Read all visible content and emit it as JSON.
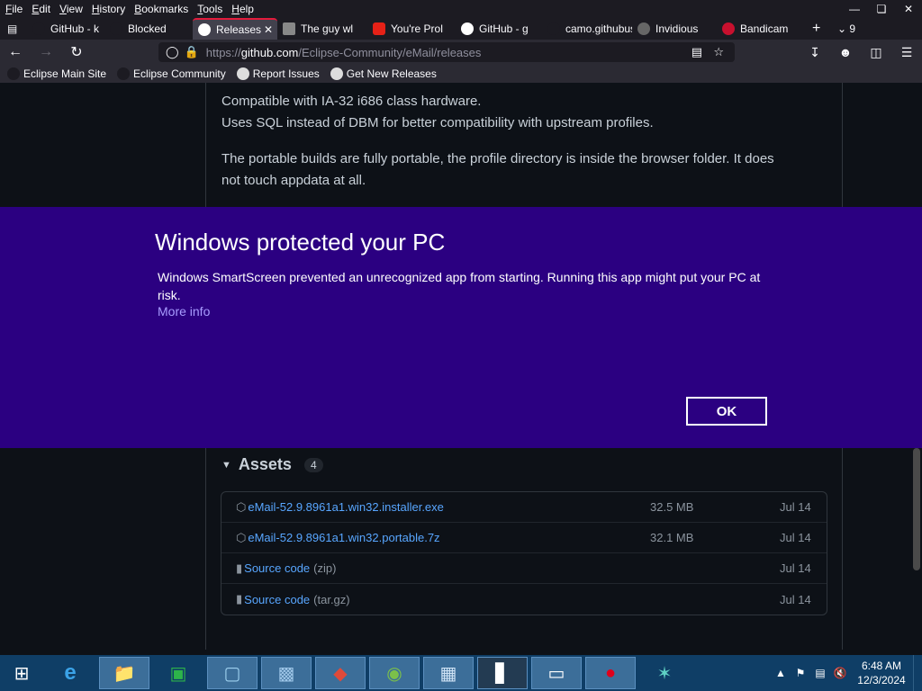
{
  "menubar": {
    "items": [
      "File",
      "Edit",
      "View",
      "History",
      "Bookmarks",
      "Tools",
      "Help"
    ],
    "underline": [
      "F",
      "E",
      "V",
      "H",
      "B",
      "T",
      "H"
    ]
  },
  "tabs": [
    {
      "title": "GitHub - k",
      "active": false
    },
    {
      "title": "Blocked",
      "active": false
    },
    {
      "title": "Releases",
      "active": true
    },
    {
      "title": "The guy wl",
      "active": false
    },
    {
      "title": "You're Prol",
      "active": false
    },
    {
      "title": "GitHub - g",
      "active": false
    },
    {
      "title": "camo.githubus",
      "active": false
    },
    {
      "title": "Invidious",
      "active": false
    },
    {
      "title": "Bandicam",
      "active": false
    }
  ],
  "tab_count": "9",
  "url": {
    "prefix": "https://",
    "host": "github.com",
    "path": "/Eclipse-Community/eMail/releases"
  },
  "bookmarks": [
    "Eclipse Main Site",
    "Eclipse Community",
    "Report Issues",
    "Get New Releases"
  ],
  "content": {
    "line1": "Compatible with IA-32 i686 class hardware.",
    "line2": "Uses SQL instead of DBM for better compatibility with upstream profiles.",
    "para1": "The portable builds are fully portable, the profile directory is inside the browser folder. It does",
    "para2": "not touch appdata at all.",
    "assets_label": "Assets",
    "assets_count": "4",
    "assets": [
      {
        "name": "eMail-52.9.8961a1.win32.installer.exe",
        "kind": "",
        "size": "32.5 MB",
        "date": "Jul 14",
        "icon": "package-icon"
      },
      {
        "name": "eMail-52.9.8961a1.win32.portable.7z",
        "kind": "",
        "size": "32.1 MB",
        "date": "Jul 14",
        "icon": "package-icon"
      },
      {
        "name": "Source code",
        "kind": "(zip)",
        "size": "",
        "date": "Jul 14",
        "icon": "file-zip-icon"
      },
      {
        "name": "Source code",
        "kind": "(tar.gz)",
        "size": "",
        "date": "Jul 14",
        "icon": "file-zip-icon"
      }
    ]
  },
  "smartscreen": {
    "title": "Windows protected your PC",
    "message": "Windows SmartScreen prevented an unrecognized app from starting. Running this app might put your PC at risk.",
    "more_info": "More info",
    "ok": "OK"
  },
  "clock": {
    "time": "6:48 AM",
    "date": "12/3/2024"
  }
}
